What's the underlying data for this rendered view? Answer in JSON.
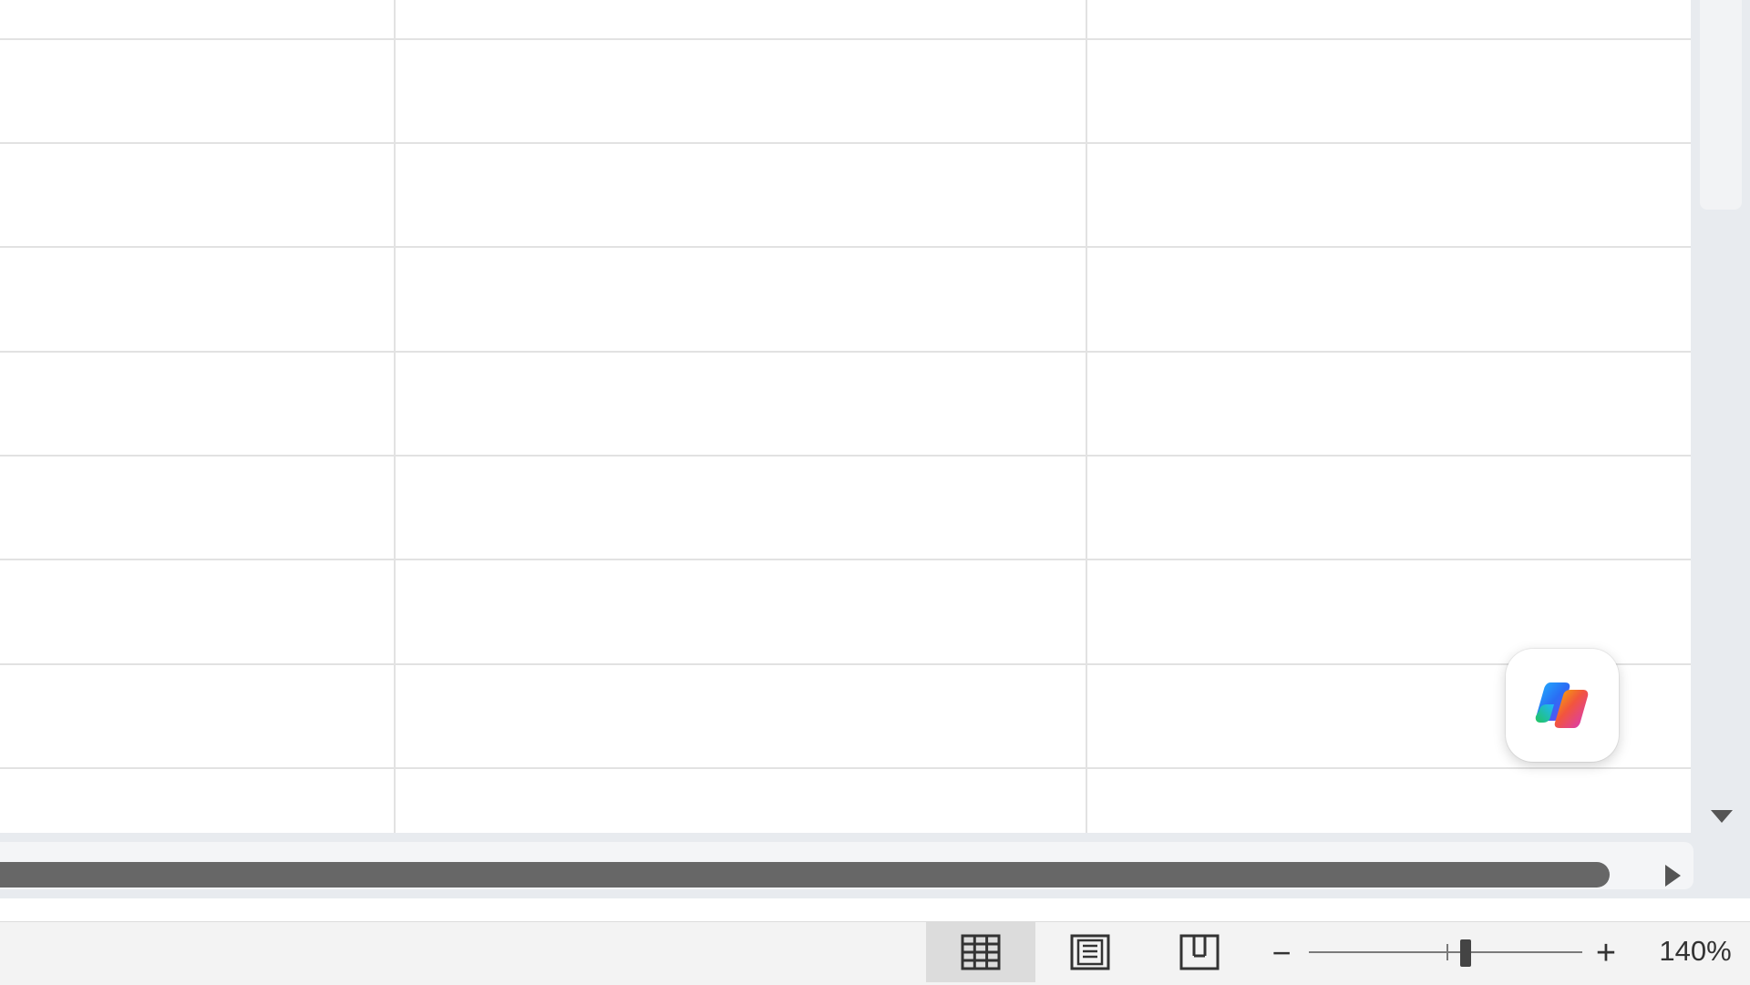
{
  "statusbar": {
    "views": [
      {
        "name": "normal",
        "icon": "grid-view-icon",
        "active": true
      },
      {
        "name": "page-layout",
        "icon": "page-layout-icon",
        "active": false
      },
      {
        "name": "page-break-preview",
        "icon": "page-break-preview-icon",
        "active": false
      }
    ],
    "zoom_minus": "−",
    "zoom_plus": "+",
    "zoom_level": "140%",
    "zoom_percent": 140
  },
  "copilot": {
    "icon": "copilot-icon"
  },
  "colors": {
    "gridline": "#e2e2e2",
    "scroll_thumb": "#676767",
    "statusbar_bg": "#f3f3f3",
    "active_view_bg": "#dcdcdc"
  }
}
